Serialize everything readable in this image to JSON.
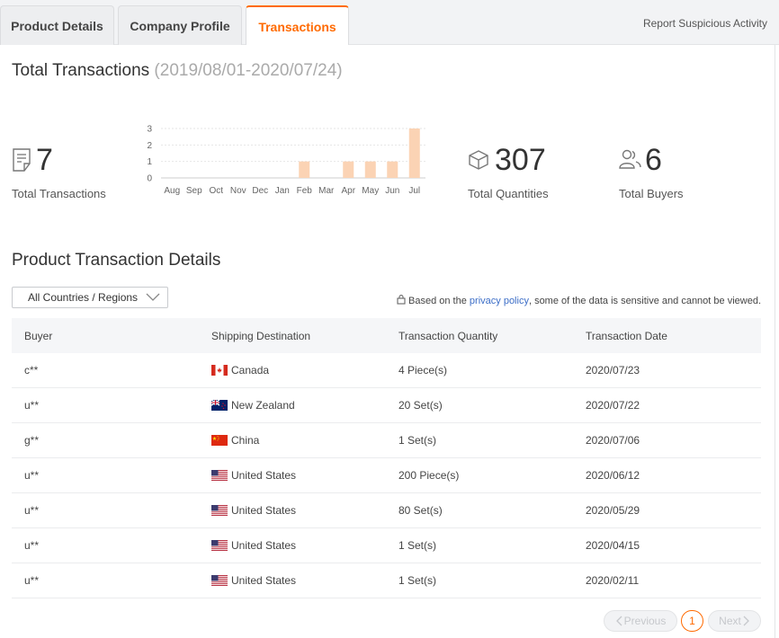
{
  "tabs": [
    {
      "label": "Product Details"
    },
    {
      "label": "Company Profile"
    },
    {
      "label": "Transactions"
    }
  ],
  "report_link": "Report Suspicious Activity",
  "header": {
    "title": "Total Transactions",
    "range": "(2019/08/01-2020/07/24)"
  },
  "stats": {
    "transactions": {
      "value": "7",
      "label": "Total Transactions",
      "icon": "receipt-icon"
    },
    "quantities": {
      "value": "307",
      "label": "Total Quantities",
      "icon": "box-icon"
    },
    "buyers": {
      "value": "6",
      "label": "Total Buyers",
      "icon": "users-icon"
    }
  },
  "chart_data": {
    "type": "bar",
    "categories": [
      "Aug",
      "Sep",
      "Oct",
      "Nov",
      "Dec",
      "Jan",
      "Feb",
      "Mar",
      "Apr",
      "May",
      "Jun",
      "Jul"
    ],
    "values": [
      0,
      0,
      0,
      0,
      0,
      0,
      1,
      0,
      1,
      1,
      1,
      3
    ],
    "yticks": [
      "0",
      "1",
      "2",
      "3"
    ],
    "ylim": [
      0,
      3
    ],
    "bar_color": "#fbd3b4",
    "grid": true
  },
  "details": {
    "title": "Product Transaction Details",
    "country_filter": "All Countries / Regions",
    "privacy_prefix": "Based on the",
    "privacy_link": "privacy policy",
    "privacy_suffix": ", some of the data is sensitive and cannot be viewed."
  },
  "table": {
    "headers": [
      "Buyer",
      "Shipping Destination",
      "Transaction Quantity",
      "Transaction Date"
    ],
    "rows": [
      {
        "buyer": "c**",
        "flag": "ca",
        "destination": "Canada",
        "quantity": "4 Piece(s)",
        "date": "2020/07/23"
      },
      {
        "buyer": "u**",
        "flag": "nz",
        "destination": "New Zealand",
        "quantity": "20 Set(s)",
        "date": "2020/07/22"
      },
      {
        "buyer": "g**",
        "flag": "cn",
        "destination": "China",
        "quantity": "1 Set(s)",
        "date": "2020/07/06"
      },
      {
        "buyer": "u**",
        "flag": "us",
        "destination": "United States",
        "quantity": "200 Piece(s)",
        "date": "2020/06/12"
      },
      {
        "buyer": "u**",
        "flag": "us",
        "destination": "United States",
        "quantity": "80 Set(s)",
        "date": "2020/05/29"
      },
      {
        "buyer": "u**",
        "flag": "us",
        "destination": "United States",
        "quantity": "1 Set(s)",
        "date": "2020/04/15"
      },
      {
        "buyer": "u**",
        "flag": "us",
        "destination": "United States",
        "quantity": "1 Set(s)",
        "date": "2020/02/11"
      }
    ]
  },
  "pagination": {
    "previous": "Previous",
    "current": "1",
    "next": "Next"
  },
  "colors": {
    "accent": "#ff6a00",
    "link": "#3c6ec7"
  }
}
